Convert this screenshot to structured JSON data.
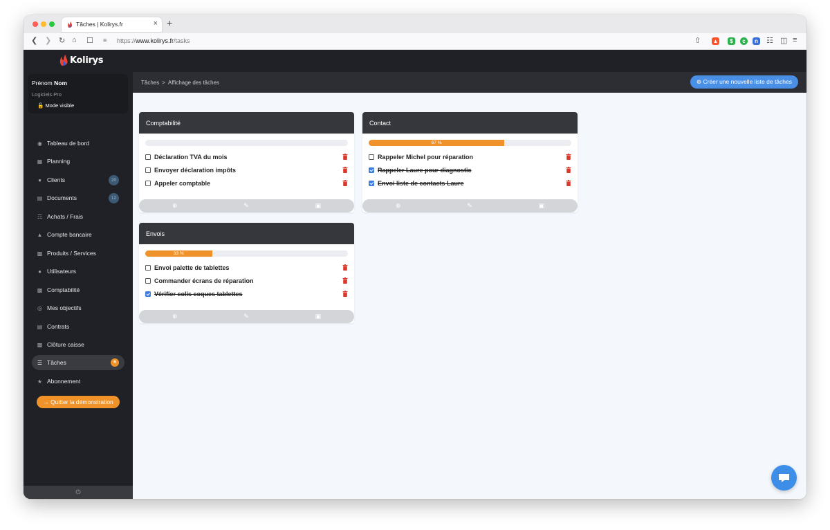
{
  "browser": {
    "tab_title": "Tâches | Kolirys.fr",
    "new_tab": "+",
    "close_tab": "×",
    "url_prefix": "https://",
    "url_main": "www.kolirys.fr",
    "url_path": "/tasks"
  },
  "app": {
    "logo_text": "Kolirys",
    "brand_color": "#f0922a",
    "accent_color": "#4a8fe6"
  },
  "profile": {
    "first_name": "Prénom",
    "last_name": "Nom",
    "company": "Logiciels.Pro",
    "mode": "Mode visible"
  },
  "sidebar": {
    "items": [
      {
        "label": "Tableau de bord",
        "icon": "dashboard-icon"
      },
      {
        "label": "Planning",
        "icon": "calendar-icon"
      },
      {
        "label": "Clients",
        "icon": "users-icon",
        "badge": "20"
      },
      {
        "label": "Documents",
        "icon": "document-icon",
        "badge": "12"
      },
      {
        "label": "Achats / Frais",
        "icon": "cart-icon"
      },
      {
        "label": "Compte bancaire",
        "icon": "bank-icon"
      },
      {
        "label": "Produits / Services",
        "icon": "boxes-icon"
      },
      {
        "label": "Utilisateurs",
        "icon": "user-group-icon"
      },
      {
        "label": "Comptabilité",
        "icon": "money-icon"
      },
      {
        "label": "Mes objectifs",
        "icon": "target-icon"
      },
      {
        "label": "Contrats",
        "icon": "contract-icon"
      },
      {
        "label": "Clôture caisse",
        "icon": "cash-register-icon"
      },
      {
        "label": "Tâches",
        "icon": "tasks-icon",
        "badge": "6",
        "active": true
      },
      {
        "label": "Abonnement",
        "icon": "star-icon"
      }
    ],
    "quit_button": "→ Quitter la démonstration",
    "footer_icon": "power-icon"
  },
  "header": {
    "breadcrumb_root": "Tâches",
    "breadcrumb_sep": ">",
    "breadcrumb_current": "Affichage des tâches",
    "create_button": "Créer une nouvelle liste de tâches"
  },
  "lists": [
    {
      "title": "Comptabilité",
      "progress": 0,
      "progress_label": "",
      "tasks": [
        {
          "label": "Déclaration TVA du mois",
          "done": false
        },
        {
          "label": "Envoyer déclaration impôts",
          "done": false
        },
        {
          "label": "Appeler comptable",
          "done": false
        }
      ]
    },
    {
      "title": "Contact",
      "progress": 0.67,
      "progress_label": "67 %",
      "tasks": [
        {
          "label": "Rappeler Michel pour réparation",
          "done": false
        },
        {
          "label": "Rappeler Laure pour diagnostic",
          "done": true
        },
        {
          "label": "Envoi liste de contacts Laure",
          "done": true
        }
      ]
    },
    {
      "title": "Envois",
      "progress": 0.33,
      "progress_label": "33 %",
      "tasks": [
        {
          "label": "Envoi palette de tablettes",
          "done": false
        },
        {
          "label": "Commander écrans de réparation",
          "done": false
        },
        {
          "label": "Vérifier colis coques tablettes",
          "done": true
        }
      ]
    }
  ]
}
